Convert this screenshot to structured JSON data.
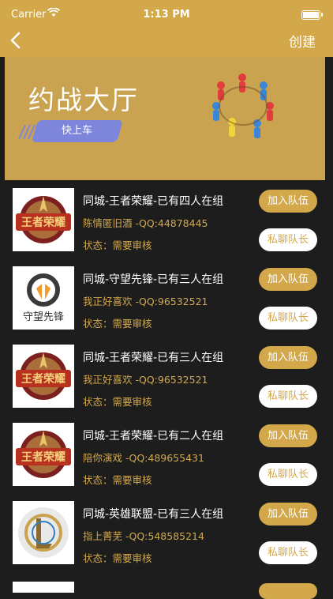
{
  "status_bar": {
    "carrier": "Carrier",
    "time": "1:13 PM"
  },
  "nav": {
    "back_icon": "chevron-left-icon",
    "create_label": "创建"
  },
  "banner": {
    "title": "约战大厅",
    "button_label": "快上车",
    "illustration": "people-circle-icon"
  },
  "groups": [
    {
      "game_logo": "王者荣耀",
      "title": "同城-王者荣耀-已有四人在组",
      "leader": "陈情匿旧酒 -QQ:44878445",
      "state": "状态：需要审核",
      "join_label": "加入队伍",
      "chat_label": "私聊队长"
    },
    {
      "game_logo": "守望先锋",
      "title": "同城-守望先锋-已有三人在组",
      "leader": "我正好喜欢 -QQ:96532521",
      "state": "状态：需要审核",
      "join_label": "加入队伍",
      "chat_label": "私聊队长"
    },
    {
      "game_logo": "王者荣耀",
      "title": "同城-王者荣耀-已有三人在组",
      "leader": "我正好喜欢 -QQ:96532521",
      "state": "状态：需要审核",
      "join_label": "加入队伍",
      "chat_label": "私聊队长"
    },
    {
      "game_logo": "王者荣耀",
      "title": "同城-王者荣耀-已有二人在组",
      "leader": "陪你演戏 -QQ:489655431",
      "state": "状态：需要审核",
      "join_label": "加入队伍",
      "chat_label": "私聊队长"
    },
    {
      "game_logo": "",
      "title": "同城-英雄联盟-已有三人在组",
      "leader": "指上菁芜 -QQ:548585214",
      "state": "状态：需要审核",
      "join_label": "加入队伍",
      "chat_label": "私聊队长"
    }
  ],
  "colors": {
    "accent": "#d3a84a",
    "background": "#1d1d1d",
    "button_purple": "#7e86dc"
  }
}
